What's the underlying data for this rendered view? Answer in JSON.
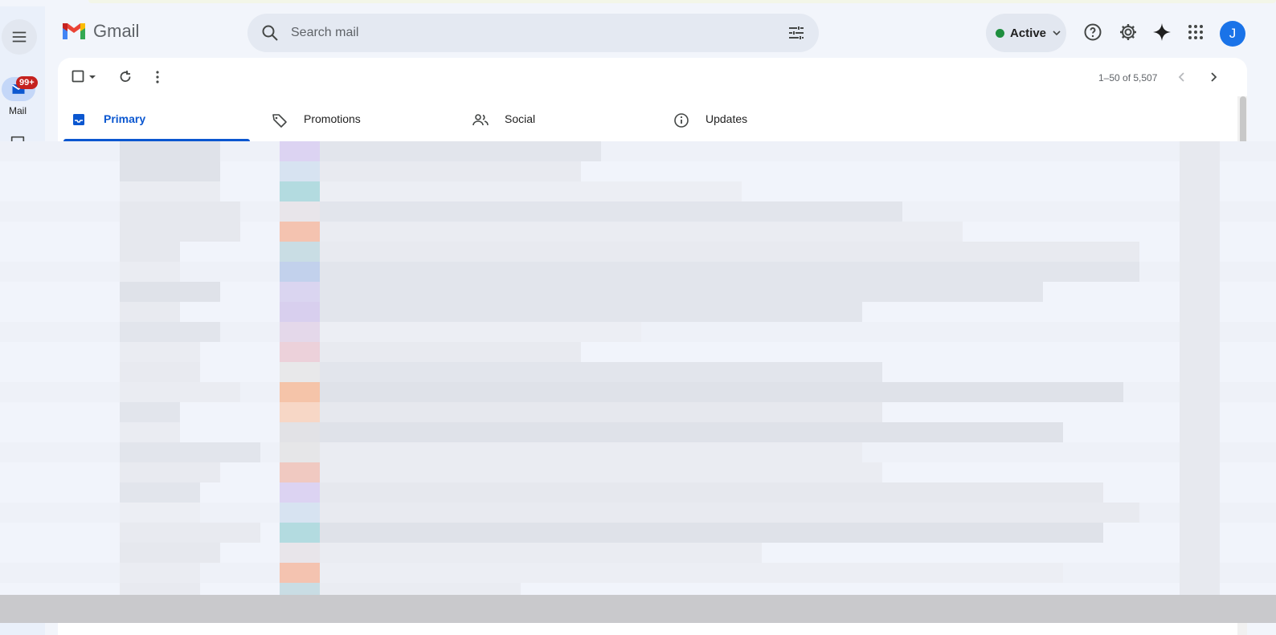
{
  "app": {
    "name": "Gmail"
  },
  "colors": {
    "accent": "#0b57d0",
    "badge": "#c5221f",
    "status_dot": "#1e8e3e",
    "avatar": "#1a73e8"
  },
  "rail": {
    "menu_icon": "hamburger-menu-icon",
    "mail": {
      "label": "Mail",
      "badge": "99+",
      "icon": "inbox-icon"
    },
    "chat_icon": "chat-icon"
  },
  "search": {
    "placeholder": "Search mail",
    "icon": "search-icon",
    "options_icon": "tune-icon"
  },
  "header": {
    "status_label": "Active",
    "avatar_letter": "J",
    "icons": [
      "help-icon",
      "settings-icon",
      "gemini-icon",
      "apps-grid-icon"
    ]
  },
  "toolbar": {
    "pagination": "1–50 of 5,507"
  },
  "tabs": [
    {
      "label": "Primary",
      "icon": "inbox-tab-icon",
      "active": true
    },
    {
      "label": "Promotions",
      "icon": "tag-icon",
      "active": false
    },
    {
      "label": "Social",
      "icon": "people-icon",
      "active": false
    },
    {
      "label": "Updates",
      "icon": "info-icon",
      "active": false
    }
  ],
  "email_list": {
    "row_count": 24,
    "redacted": true
  }
}
